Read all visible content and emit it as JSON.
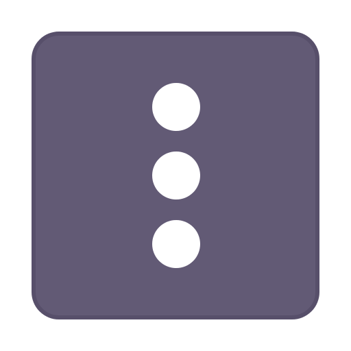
{
  "icon": {
    "name": "more-vertical-icon",
    "colors": {
      "background": "#625a75",
      "border": "#574f6a",
      "dots": "#ffffff"
    },
    "dot_count": 3
  }
}
